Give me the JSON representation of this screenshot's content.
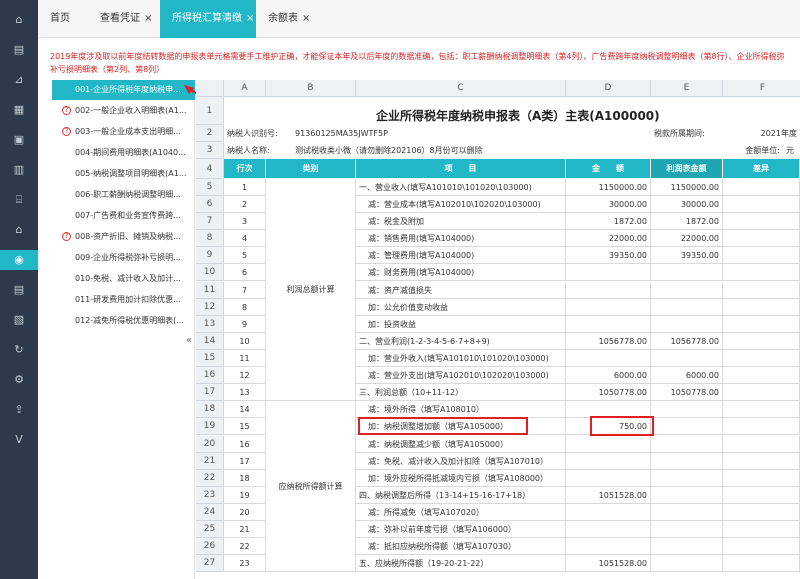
{
  "tabs": [
    {
      "label": "首页",
      "close": ""
    },
    {
      "label": "查看凭证",
      "close": "×"
    },
    {
      "label": "所得税汇算清缴",
      "close": "×"
    },
    {
      "label": "余额表",
      "close": "×"
    }
  ],
  "notice": "2019年度涉及取以前年度结转数据的申报表单元格需要手工维护正确，才能保证本年及以后年度的数据准确，包括：职工薪酬纳税调整明细表（第4列）、广告费跨年度纳税调整明细表（第8行）、企业所得税弥补亏损明细表（第2列、第8列）",
  "sidebar": {
    "items": [
      {
        "label": "001-企业所得税年度纳税申...",
        "warn": ""
      },
      {
        "label": "002-一般企业收入明细表(A1...",
        "warn": "?"
      },
      {
        "label": "003-一般企业成本支出明细...",
        "warn": "?"
      },
      {
        "label": "004-期间费用明细表(A1040...",
        "warn": ""
      },
      {
        "label": "005-纳税调整项目明细表(A1...",
        "warn": ""
      },
      {
        "label": "006-职工薪酬纳税调整明细...",
        "warn": ""
      },
      {
        "label": "007-广告费和业务宣传费跨...",
        "warn": ""
      },
      {
        "label": "008-资产折旧、摊销及纳税...",
        "warn": "?"
      },
      {
        "label": "009-企业所得税弥补亏损明...",
        "warn": ""
      },
      {
        "label": "010-免税、减计收入及加计...",
        "warn": ""
      },
      {
        "label": "011-研发费用加计扣除优惠...",
        "warn": ""
      },
      {
        "label": "012-减免所得税优惠明细表(...",
        "warn": ""
      }
    ],
    "collapse_glyph": "«"
  },
  "grid": {
    "columns": [
      "A",
      "B",
      "C",
      "D",
      "E",
      "F"
    ],
    "title": "企业所得税年度纳税申报表（A类）主表(A100000)",
    "taxpayer_id_label": "纳税人识别号:",
    "taxpayer_id": "91360125MA35JWTF5P",
    "taxpayer_name_label": "纳税人名称:",
    "taxpayer_name": "测试税收类小微（请勿删除202106）8月份可以删除",
    "period_label": "税款所属期间:",
    "period": "2021年度",
    "unit_label": "金额单位:",
    "unit": "元",
    "headers": {
      "h1": "行次",
      "h2": "类别",
      "h3": "项　　目",
      "h4": "金　　额",
      "h5": "利润表金额",
      "h6": "差异"
    },
    "category_profit": "利润总额计算",
    "category_tax": "应纳税所得额计算",
    "rows": [
      {
        "n": "5",
        "line": "1",
        "item": "一、营业收入(填写A101010\\101020\\103000)",
        "amt": "1150000.00",
        "pl": "1150000.00"
      },
      {
        "n": "6",
        "line": "2",
        "item": "减：营业成本(填写A102010\\102020\\103000)",
        "amt": "30000.00",
        "pl": "30000.00"
      },
      {
        "n": "7",
        "line": "3",
        "item": "减：税金及附加",
        "amt": "1872.00",
        "pl": "1872.00"
      },
      {
        "n": "8",
        "line": "4",
        "item": "减：销售费用(填写A104000)",
        "amt": "22000.00",
        "pl": "22000.00"
      },
      {
        "n": "9",
        "line": "5",
        "item": "减：管理费用(填写A104000)",
        "amt": "39350.00",
        "pl": "39350.00"
      },
      {
        "n": "10",
        "line": "6",
        "item": "减：财务费用(填写A104000)",
        "amt": "",
        "pl": ""
      },
      {
        "n": "11",
        "line": "7",
        "item": "减：资产减值损失",
        "amt": "",
        "pl": ""
      },
      {
        "n": "12",
        "line": "8",
        "item": "加：公允价值变动收益",
        "amt": "",
        "pl": ""
      },
      {
        "n": "13",
        "line": "9",
        "item": "加：投资收益",
        "amt": "",
        "pl": ""
      },
      {
        "n": "14",
        "line": "10",
        "item": "二、营业利润(1-2-3-4-5-6-7+8+9)",
        "amt": "1056778.00",
        "pl": "1056778.00"
      },
      {
        "n": "15",
        "line": "11",
        "item": "加：营业外收入(填写A101010\\101020\\103000)",
        "amt": "",
        "pl": ""
      },
      {
        "n": "16",
        "line": "12",
        "item": "减：营业外支出(填写A102010\\102020\\103000)",
        "amt": "6000.00",
        "pl": "6000.00"
      },
      {
        "n": "17",
        "line": "13",
        "item": "三、利润总额（10+11-12）",
        "amt": "1050778.00",
        "pl": "1050778.00"
      },
      {
        "n": "18",
        "line": "14",
        "item": "减：境外所得（填写A108010）",
        "amt": "",
        "pl": ""
      },
      {
        "n": "19",
        "line": "15",
        "item": "加：纳税调整增加额（填写A105000）",
        "amt": "750.00",
        "pl": ""
      },
      {
        "n": "20",
        "line": "16",
        "item": "减：纳税调整减少额（填写A105000）",
        "amt": "",
        "pl": ""
      },
      {
        "n": "21",
        "line": "17",
        "item": "减：免税、减计收入及加计扣除（填写A107010）",
        "amt": "",
        "pl": ""
      },
      {
        "n": "22",
        "line": "18",
        "item": "加：境外应税所得抵减境内亏损（填写A108000）",
        "amt": "",
        "pl": ""
      },
      {
        "n": "23",
        "line": "19",
        "item": "四、纳税调整后所得（13-14+15-16-17+18）",
        "amt": "1051528.00",
        "pl": ""
      },
      {
        "n": "24",
        "line": "20",
        "item": "减：所得减免（填写A107020）",
        "amt": "",
        "pl": ""
      },
      {
        "n": "25",
        "line": "21",
        "item": "减：弥补以前年度亏损（填写A106000）",
        "amt": "",
        "pl": ""
      },
      {
        "n": "26",
        "line": "22",
        "item": "减：抵扣应纳税所得额（填写A107030）",
        "amt": "",
        "pl": ""
      },
      {
        "n": "27",
        "line": "23",
        "item": "五、应纳税所得额（19-20-21-22）",
        "amt": "1051528.00",
        "pl": ""
      }
    ]
  }
}
